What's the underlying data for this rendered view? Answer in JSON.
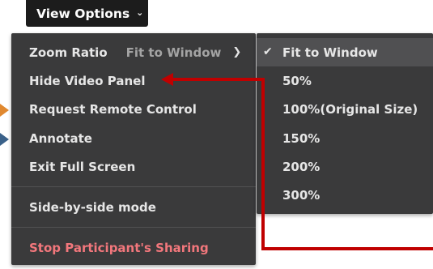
{
  "toolbar": {
    "view_options_label": "View Options",
    "chevron_icon": "chevron-down"
  },
  "menu": {
    "zoom_ratio_label": "Zoom Ratio",
    "zoom_ratio_value": "Fit to Window",
    "hide_video_panel": "Hide Video Panel",
    "request_remote_control": "Request Remote Control",
    "annotate": "Annotate",
    "exit_full_screen": "Exit Full Screen",
    "side_by_side": "Side-by-side mode",
    "stop_sharing": "Stop Participant's Sharing"
  },
  "zoom_submenu": {
    "selected": "Fit to Window",
    "options": [
      "Fit to Window",
      "50%",
      "100%(Original Size)",
      "150%",
      "200%",
      "300%"
    ]
  },
  "colors": {
    "menu_background": "#3a3a3b",
    "stop_sharing_text": "#f2777c",
    "annotation_line": "#c00000",
    "marker_orange": "#e0882f",
    "marker_blue": "#3a6189"
  }
}
